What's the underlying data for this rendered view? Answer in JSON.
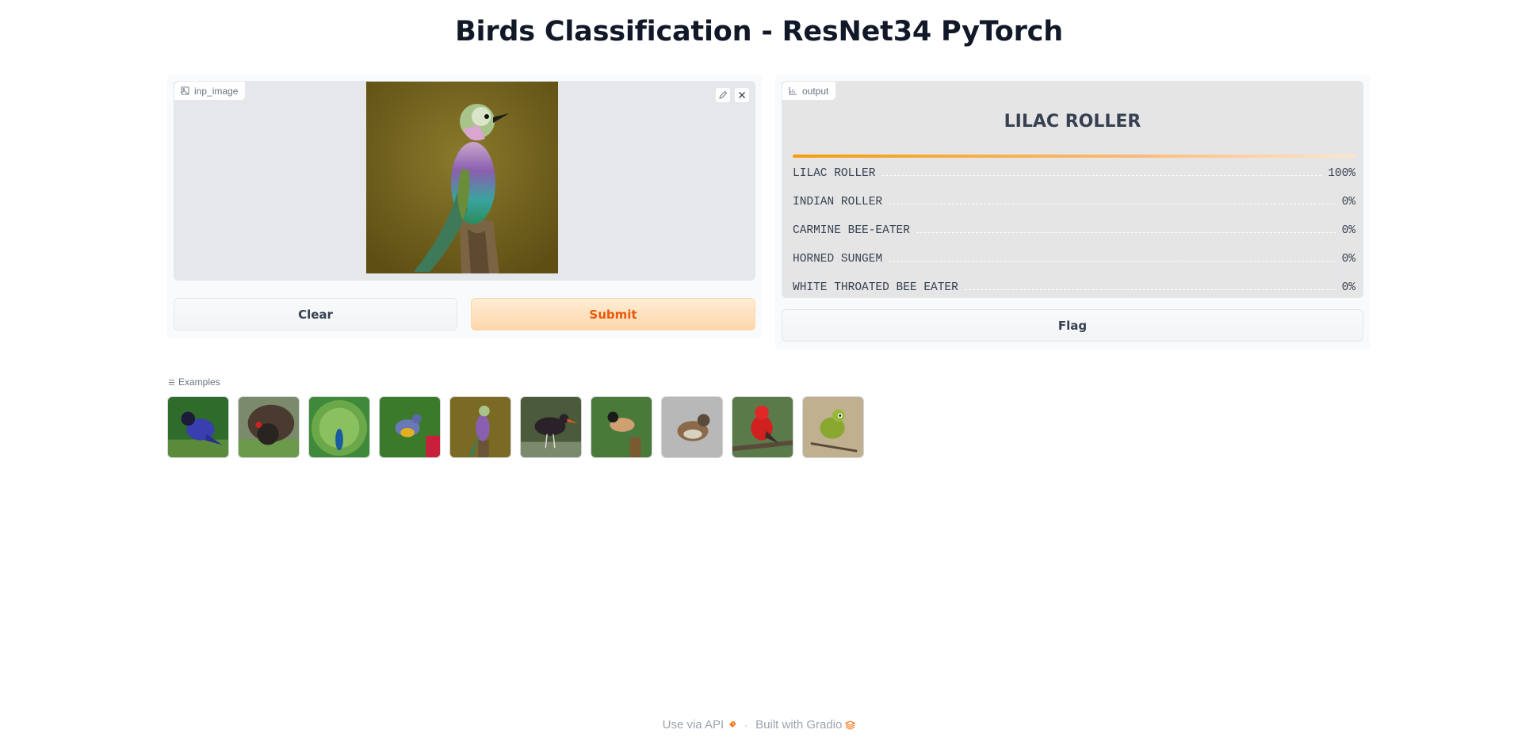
{
  "title": "Birds Classification - ResNet34 PyTorch",
  "input": {
    "label": "inp_image"
  },
  "buttons": {
    "clear": "Clear",
    "submit": "Submit",
    "flag": "Flag"
  },
  "output": {
    "label": "output",
    "top_label": "LILAC ROLLER",
    "confidences": [
      {
        "label": "LILAC ROLLER",
        "value": "100%"
      },
      {
        "label": "INDIAN ROLLER",
        "value": "0%"
      },
      {
        "label": "CARMINE BEE-EATER",
        "value": "0%"
      },
      {
        "label": "HORNED SUNGEM",
        "value": "0%"
      },
      {
        "label": "WHITE THROATED BEE EATER",
        "value": "0%"
      }
    ]
  },
  "examples": {
    "label": "Examples"
  },
  "footer": {
    "api": "Use via API",
    "separator": "·",
    "built": "Built with Gradio"
  },
  "colors": {
    "accent": "#ea580c",
    "submit_bg": "#fed7aa"
  }
}
